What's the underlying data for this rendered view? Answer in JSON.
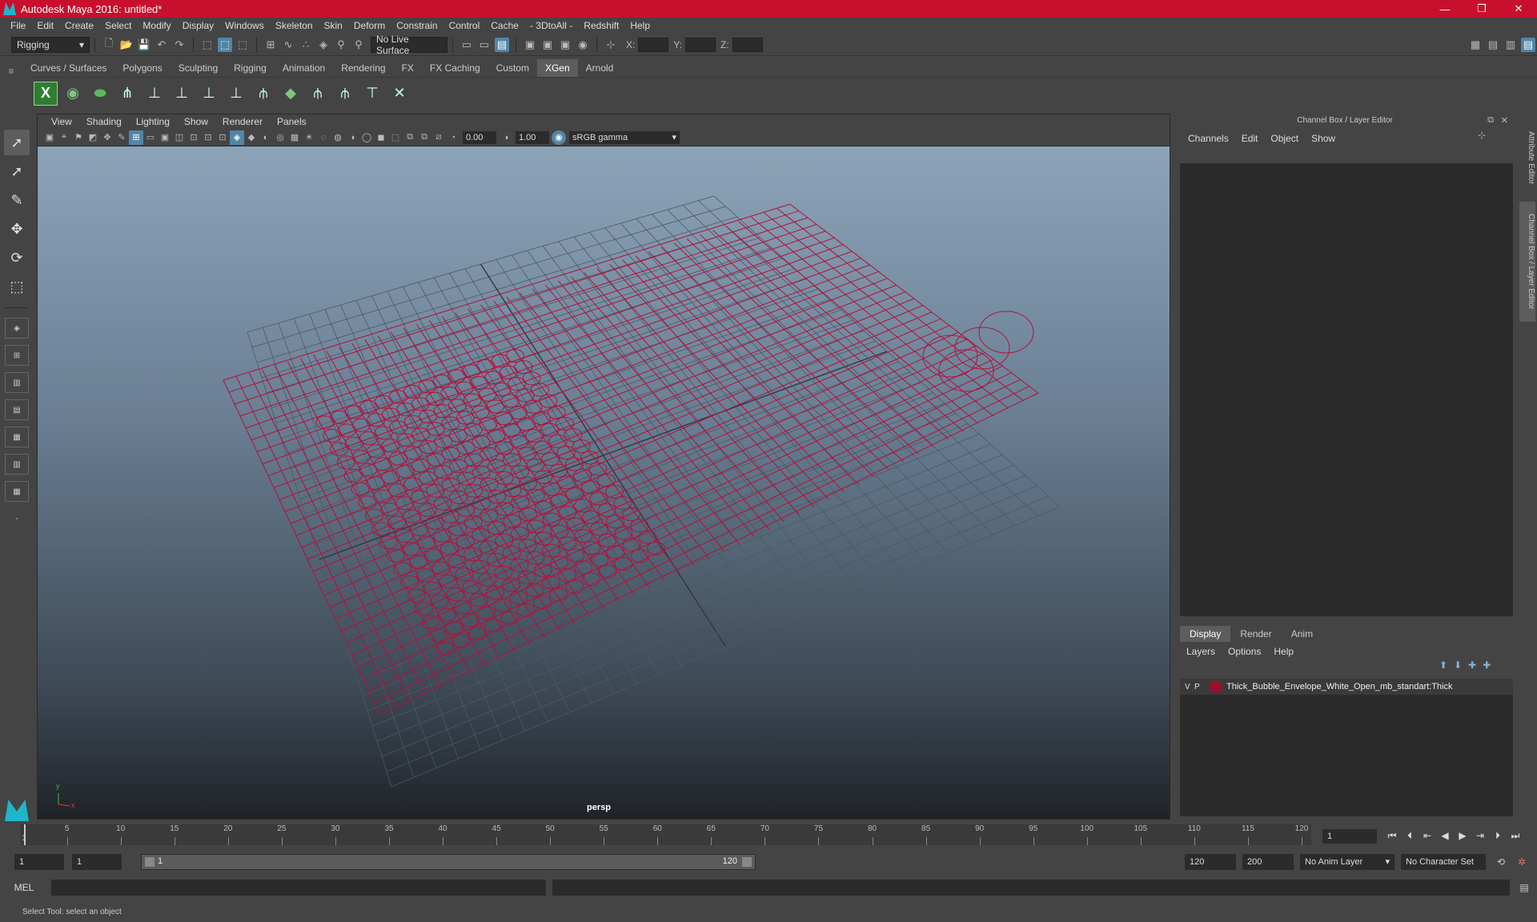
{
  "window": {
    "title": "Autodesk Maya 2016: untitled*",
    "minimize": "—",
    "restore": "❐",
    "close": "✕"
  },
  "menubar": [
    "File",
    "Edit",
    "Create",
    "Select",
    "Modify",
    "Display",
    "Windows",
    "Skeleton",
    "Skin",
    "Deform",
    "Constrain",
    "Control",
    "Cache",
    "- 3DtoAll -",
    "Redshift",
    "Help"
  ],
  "statusline": {
    "mode": "Rigging",
    "live_surface": "No Live Surface",
    "x_label": "X:",
    "y_label": "Y:",
    "z_label": "Z:"
  },
  "shelf_tabs": [
    "Curves / Surfaces",
    "Polygons",
    "Sculpting",
    "Rigging",
    "Animation",
    "Rendering",
    "FX",
    "FX Caching",
    "Custom",
    "XGen",
    "Arnold"
  ],
  "shelf_active": "XGen",
  "viewport": {
    "menu": [
      "View",
      "Shading",
      "Lighting",
      "Show",
      "Renderer",
      "Panels"
    ],
    "exposure": "0.00",
    "gamma": "1.00",
    "color_management": "sRGB gamma",
    "camera": "persp",
    "axis_y": "y",
    "axis_x": "x"
  },
  "channel_box": {
    "title": "Channel Box / Layer Editor",
    "menu": [
      "Channels",
      "Edit",
      "Object",
      "Show"
    ]
  },
  "layer_editor": {
    "tabs": [
      "Display",
      "Render",
      "Anim"
    ],
    "active_tab": "Display",
    "menu": [
      "Layers",
      "Options",
      "Help"
    ],
    "layers": [
      {
        "v": "V",
        "p": "P",
        "name": "Thick_Bubble_Envelope_White_Open_mb_standart:Thick",
        "color": "#9d0d2e"
      }
    ]
  },
  "side_tabs": [
    "Attribute Editor",
    "Channel Box / Layer Editor"
  ],
  "timeline": {
    "ticks": [
      5,
      10,
      15,
      20,
      25,
      30,
      35,
      40,
      45,
      50,
      55,
      60,
      65,
      70,
      75,
      80,
      85,
      90,
      95,
      100,
      105,
      110,
      115,
      120
    ],
    "start_mark": "1",
    "current_frame": "1"
  },
  "range": {
    "start": "1",
    "playback_start": "1",
    "slider_start": "1",
    "slider_end": "120",
    "playback_end": "120",
    "end": "200",
    "anim_layer": "No Anim Layer",
    "character_set": "No Character Set"
  },
  "command_line": {
    "label": "MEL"
  },
  "help_line": "Select Tool: select an object",
  "colors": {
    "title_bar": "#c8102e",
    "wireframe": "#b0123c",
    "accent": "#5285a6"
  }
}
